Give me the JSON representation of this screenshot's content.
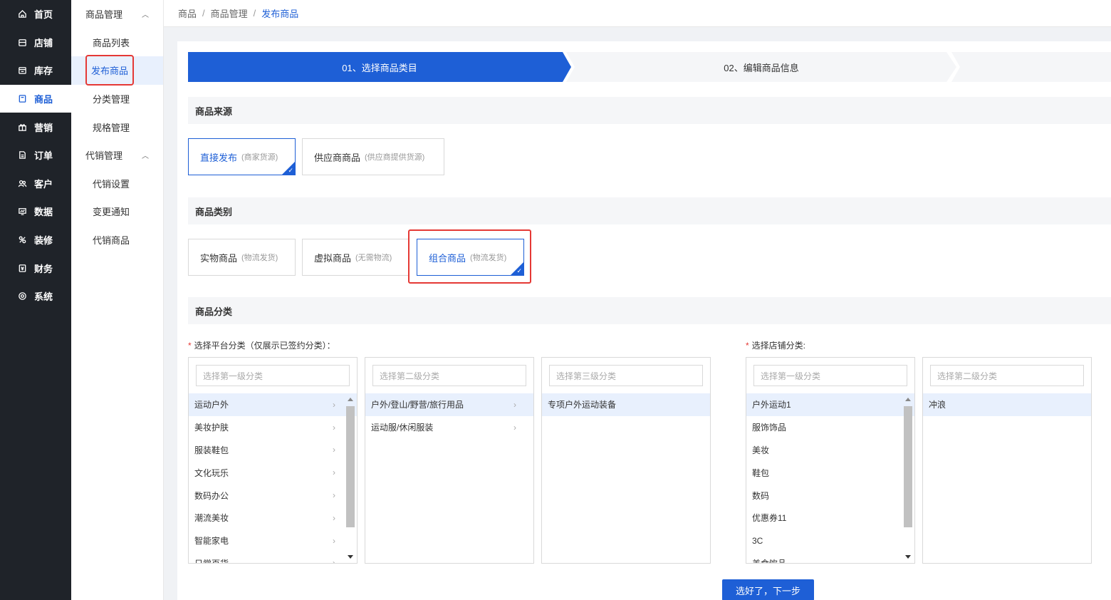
{
  "nav": [
    {
      "label": "首页",
      "icon": "home-icon"
    },
    {
      "label": "店铺",
      "icon": "store-icon"
    },
    {
      "label": "库存",
      "icon": "inventory-icon"
    },
    {
      "label": "商品",
      "icon": "product-icon",
      "active": true
    },
    {
      "label": "营销",
      "icon": "gift-icon"
    },
    {
      "label": "订单",
      "icon": "order-icon"
    },
    {
      "label": "客户",
      "icon": "customer-icon"
    },
    {
      "label": "数据",
      "icon": "data-icon"
    },
    {
      "label": "装修",
      "icon": "decorate-icon"
    },
    {
      "label": "财务",
      "icon": "finance-icon"
    },
    {
      "label": "系统",
      "icon": "settings-icon"
    }
  ],
  "submenu": {
    "group1": "商品管理",
    "items1": [
      "商品列表",
      "发布商品",
      "分类管理",
      "规格管理"
    ],
    "group2": "代销管理",
    "items2": [
      "代销设置",
      "变更通知",
      "代销商品"
    ]
  },
  "breadcrumb": [
    "商品",
    "商品管理",
    "发布商品"
  ],
  "steps": {
    "step1": "01、选择商品类目",
    "step2": "02、编辑商品信息"
  },
  "source": {
    "title": "商品来源",
    "options": [
      {
        "label": "直接发布",
        "hint": "(商家货源)",
        "selected": true
      },
      {
        "label": "供应商商品",
        "hint": "(供应商提供货源)",
        "selected": false
      }
    ]
  },
  "type": {
    "title": "商品类别",
    "options": [
      {
        "label": "实物商品",
        "hint": "(物流发货)",
        "selected": false
      },
      {
        "label": "虚拟商品",
        "hint": "(无需物流)",
        "selected": false
      },
      {
        "label": "组合商品",
        "hint": "(物流发货)",
        "selected": true
      }
    ]
  },
  "category": {
    "title": "商品分类",
    "platform_label": "选择平台分类（仅展示已签约分类）：",
    "shop_label": "选择店铺分类:",
    "col1": {
      "placeholder": "选择第一级分类",
      "items": [
        "运动户外",
        "美妆护肤",
        "服装鞋包",
        "文化玩乐",
        "数码办公",
        "潮流美妆",
        "智能家电",
        "日常百货"
      ]
    },
    "col2": {
      "placeholder": "选择第二级分类",
      "items": [
        "户外/登山/野营/旅行用品",
        "运动服/休闲服装"
      ]
    },
    "col3": {
      "placeholder": "选择第三级分类",
      "items": [
        "专项户外运动装备"
      ]
    },
    "shop1": {
      "placeholder": "选择第一级分类",
      "items": [
        "户外运动1",
        "服饰饰品",
        "美妆",
        "鞋包",
        "数码",
        "优惠券11",
        "3C",
        "美食饮品"
      ]
    },
    "shop2": {
      "placeholder": "选择第二级分类",
      "items": [
        "冲浪"
      ]
    }
  },
  "next_button": "选好了，下一步",
  "colors": {
    "primary": "#1e5fd6",
    "nav_bg": "#1f2329",
    "highlight": "#e53935"
  }
}
